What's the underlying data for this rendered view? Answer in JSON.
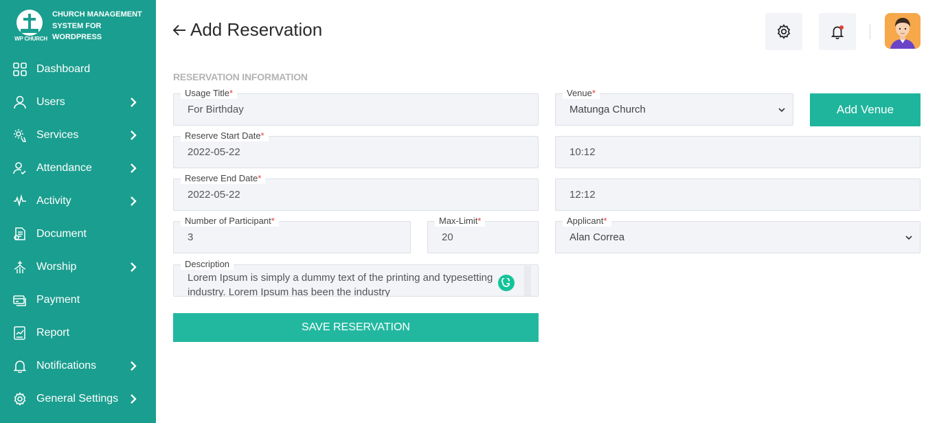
{
  "brand": {
    "name": "CHURCH MANAGEMENT SYSTEM FOR WORDPRESS",
    "logo_caption": "WP CHURCH"
  },
  "sidebar": {
    "items": [
      {
        "label": "Dashboard",
        "icon": "dashboard-grid-icon",
        "has_submenu": false
      },
      {
        "label": "Users",
        "icon": "user-icon",
        "has_submenu": true
      },
      {
        "label": "Services",
        "icon": "services-gear-icon",
        "has_submenu": true
      },
      {
        "label": "Attendance",
        "icon": "attendance-user-check-icon",
        "has_submenu": true
      },
      {
        "label": "Activity",
        "icon": "activity-pulse-icon",
        "has_submenu": true
      },
      {
        "label": "Document",
        "icon": "document-icon",
        "has_submenu": false
      },
      {
        "label": "Worship",
        "icon": "worship-icon",
        "has_submenu": true
      },
      {
        "label": "Payment",
        "icon": "payment-icon",
        "has_submenu": false
      },
      {
        "label": "Report",
        "icon": "report-icon",
        "has_submenu": false
      },
      {
        "label": "Notifications",
        "icon": "bell-icon",
        "has_submenu": true
      },
      {
        "label": "General Settings",
        "icon": "gear-icon",
        "has_submenu": true
      }
    ]
  },
  "header": {
    "title": "Add Reservation"
  },
  "form": {
    "section_title": "RESERVATION INFORMATION",
    "usage_title": {
      "label": "Usage Title",
      "value": "For Birthday"
    },
    "venue": {
      "label": "Venue",
      "value": "Matunga Church"
    },
    "add_venue_label": "Add Venue",
    "start_date": {
      "label": "Reserve Start Date",
      "value": "2022-05-22"
    },
    "start_time": {
      "value": "10:12"
    },
    "end_date": {
      "label": "Reserve End Date",
      "value": "2022-05-22"
    },
    "end_time": {
      "value": "12:12"
    },
    "participants": {
      "label": "Number of Participant",
      "value": "3"
    },
    "max_limit": {
      "label": "Max-Limit",
      "value": "20"
    },
    "applicant": {
      "label": "Applicant",
      "value": "Alan Correa"
    },
    "description": {
      "label": "Description",
      "value": "Lorem Ipsum is simply a dummy text of the printing and typesetting industry. Lorem Ipsum has been the industry"
    },
    "required_mark": "*",
    "save_label": "SAVE RESERVATION"
  },
  "colors": {
    "sidebar_bg": "#1a9e8f",
    "accent": "#1fb59c",
    "field_bg": "#f2f4f8",
    "required": "#e53935",
    "notification_dot": "#e53935",
    "avatar_bg": "#f6a84b"
  }
}
